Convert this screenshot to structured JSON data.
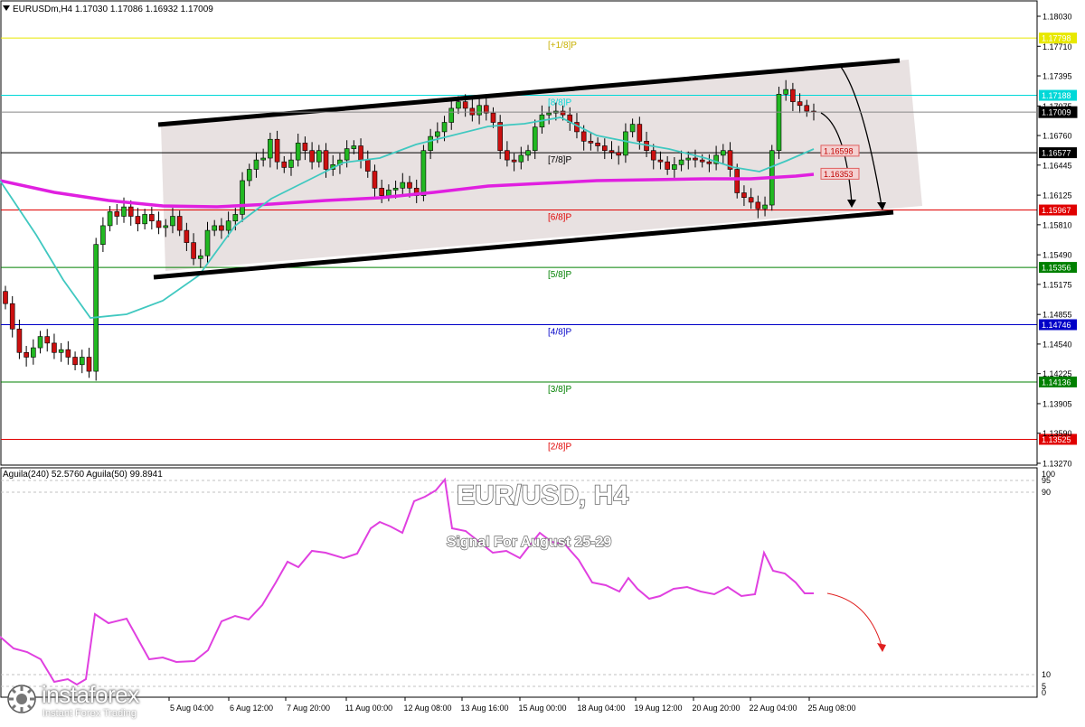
{
  "header": {
    "symbol_line": "EURUSDm,H4  1.17030 1.17086 1.16932 1.17009"
  },
  "indicator": {
    "header": "Aguila(240) 52.5760  Aguila(50) 99.8941",
    "levels": [
      "100",
      "95",
      "90",
      "10",
      "5",
      "0"
    ]
  },
  "overlay": {
    "title": "EUR/USD, H4",
    "subtitle": "Signal For August 25-29"
  },
  "brand": {
    "name": "instaforex",
    "tagline": "Instant Forex Trading"
  },
  "price_axis": {
    "ticks": [
      "1.18030",
      "1.17710",
      "1.17395",
      "1.17075",
      "1.16760",
      "1.16445",
      "1.16125",
      "1.15810",
      "1.15490",
      "1.15175",
      "1.14855",
      "1.14540",
      "1.14225",
      "1.13905",
      "1.13590",
      "1.13270"
    ]
  },
  "time_axis": {
    "labels": [
      "5 Aug 04:00",
      "6 Aug 12:00",
      "7 Aug 20:00",
      "11 Aug 00:00",
      "12 Aug 08:00",
      "13 Aug 16:00",
      "15 Aug 00:00",
      "18 Aug 04:00",
      "19 Aug 12:00",
      "20 Aug 20:00",
      "22 Aug 04:00",
      "25 Aug 08:00"
    ]
  },
  "murrey_levels": [
    {
      "label": "[+1/8]P",
      "price": "1.17798",
      "color": "#e8e800"
    },
    {
      "label": "[8/8]P",
      "price": "1.17188",
      "color": "#00d8d8"
    },
    {
      "label": "[7/8]P",
      "price": "1.16577",
      "color": "#000000"
    },
    {
      "label": "[6/8]P",
      "price": "1.15967",
      "color": "#e00000"
    },
    {
      "label": "[5/8]P",
      "price": "1.15356",
      "color": "#008000"
    },
    {
      "label": "[4/8]P",
      "price": "1.14746",
      "color": "#0000c8"
    },
    {
      "label": "[3/8]P",
      "price": "1.14136",
      "color": "#008000"
    },
    {
      "label": "[2/8]P",
      "price": "1.13525",
      "color": "#e00000"
    }
  ],
  "price_markers": [
    {
      "price": "1.17009",
      "color": "#000000"
    },
    {
      "price": "1.16598",
      "color": "#e06060"
    },
    {
      "price": "1.16353",
      "color": "#e06060"
    }
  ],
  "colors": {
    "up_candle": "#22b822",
    "down_candle": "#cc1010",
    "ma_fast": "#40c8c0",
    "ma_slow": "#e020e0",
    "channel_fill": "#e8e0e0",
    "indicator_line": "#e040e0",
    "forecast_arrow": "#e02020"
  },
  "chart_data": {
    "type": "candlestick",
    "price_range": [
      1.1327,
      1.1811
    ],
    "current_price": 1.17009,
    "ohlc_sample": {
      "open": 1.1703,
      "high": 1.17086,
      "low": 1.16932,
      "close": 1.17009
    },
    "levels": {
      "+1/8": 1.17798,
      "8/8": 1.17188,
      "7/8": 1.16577,
      "6/8": 1.15967,
      "5/8": 1.15356,
      "4/8": 1.14746,
      "3/8": 1.14136,
      "2/8": 1.13525
    },
    "ma_fast_last": 1.16598,
    "ma_slow_last": 1.16353,
    "indicator_range": [
      0,
      100
    ]
  }
}
